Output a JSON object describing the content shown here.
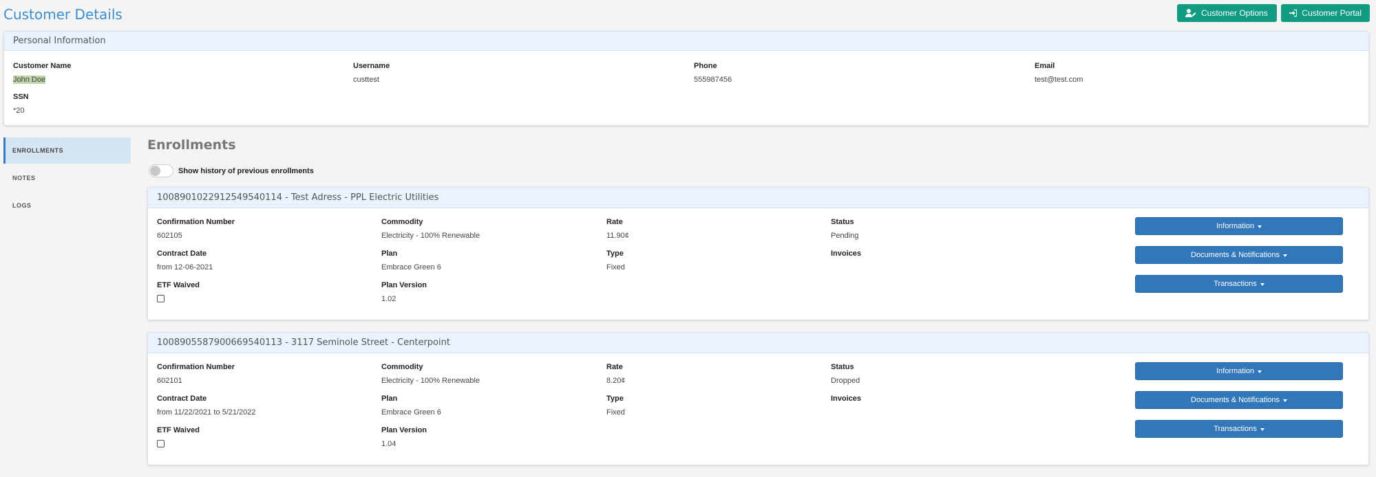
{
  "page": {
    "title": "Customer Details"
  },
  "header_buttons": {
    "options": "Customer Options",
    "portal": "Customer Portal"
  },
  "personal": {
    "header": "Personal Information",
    "customer_name_label": "Customer Name",
    "customer_name": "John Doe",
    "username_label": "Username",
    "username": "custtest",
    "phone_label": "Phone",
    "phone": "555987456",
    "email_label": "Email",
    "email": "test@test.com",
    "ssn_label": "SSN",
    "ssn": "*20"
  },
  "sidebar": {
    "items": [
      "ENROLLMENTS",
      "NOTES",
      "LOGS"
    ]
  },
  "enrollments": {
    "title": "Enrollments",
    "toggle_label": "Show history of previous enrollments",
    "labels": {
      "confirmation": "Confirmation Number",
      "commodity": "Commodity",
      "rate": "Rate",
      "status": "Status",
      "contract_date": "Contract Date",
      "plan": "Plan",
      "type": "Type",
      "invoices": "Invoices",
      "etf_waived": "ETF Waived",
      "plan_version": "Plan Version"
    },
    "actions": {
      "information": "Information",
      "documents": "Documents & Notifications",
      "transactions": "Transactions"
    },
    "items": [
      {
        "header": "1008901022912549540114 - Test Adress - PPL Electric Utilities",
        "confirmation": "602105",
        "commodity": "Electricity - 100% Renewable",
        "rate": "11.90¢",
        "status": "Pending",
        "contract_date": "from 12-06-2021",
        "plan": "Embrace Green 6",
        "type": "Fixed",
        "etf_waived": false,
        "plan_version": "1.02"
      },
      {
        "header": "1008905587900669540113 - 3117 Seminole Street - Centerpoint",
        "confirmation": "602101",
        "commodity": "Electricity - 100% Renewable",
        "rate": "8.20¢",
        "status": "Dropped",
        "contract_date": "from 11/22/2021 to 5/21/2022",
        "plan": "Embrace Green 6",
        "type": "Fixed",
        "etf_waived": false,
        "plan_version": "1.04"
      }
    ]
  },
  "colors": {
    "title_blue": "#3a8ed0",
    "teal_button": "#119c82",
    "action_blue": "#3377bb",
    "header_bg": "#e9f3fd"
  }
}
